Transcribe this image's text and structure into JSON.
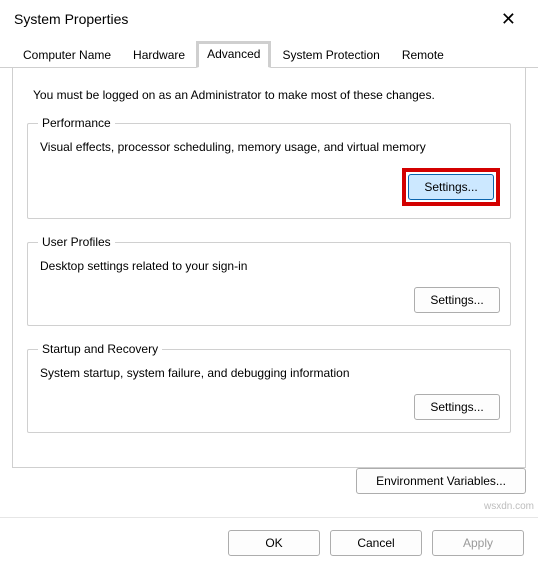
{
  "window": {
    "title": "System Properties"
  },
  "tabs": {
    "computer_name": "Computer Name",
    "hardware": "Hardware",
    "advanced": "Advanced",
    "system_protection": "System Protection",
    "remote": "Remote"
  },
  "advanced_pane": {
    "note": "You must be logged on as an Administrator to make most of these changes.",
    "performance": {
      "legend": "Performance",
      "desc": "Visual effects, processor scheduling, memory usage, and virtual memory",
      "button": "Settings..."
    },
    "user_profiles": {
      "legend": "User Profiles",
      "desc": "Desktop settings related to your sign-in",
      "button": "Settings..."
    },
    "startup_recovery": {
      "legend": "Startup and Recovery",
      "desc": "System startup, system failure, and debugging information",
      "button": "Settings..."
    },
    "env_button": "Environment Variables..."
  },
  "buttons": {
    "ok": "OK",
    "cancel": "Cancel",
    "apply": "Apply"
  },
  "watermark": "wsxdn.com"
}
